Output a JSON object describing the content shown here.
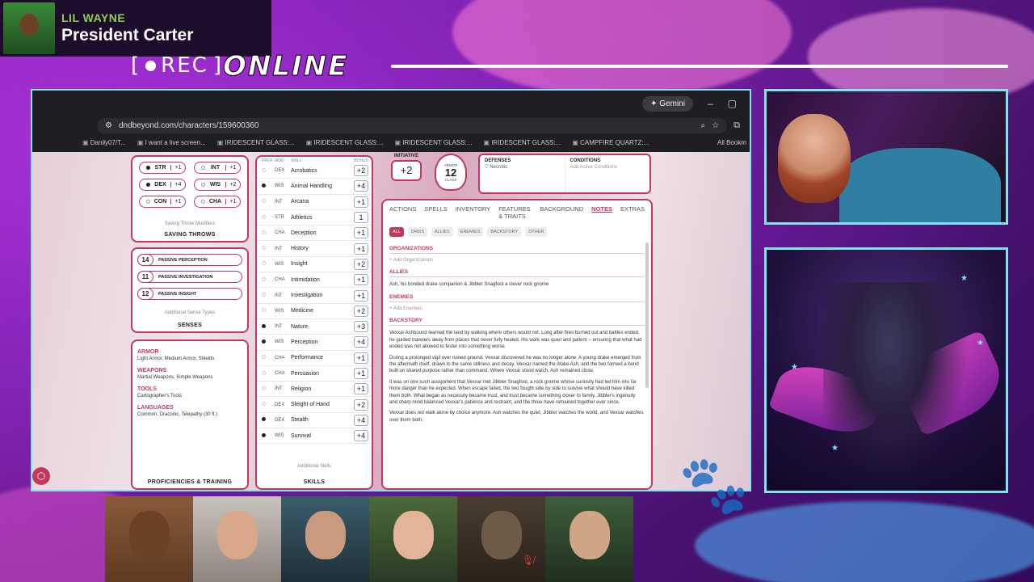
{
  "overlay": {
    "artist": "LIL WAYNE",
    "track": "President Carter",
    "rec_label": "REC",
    "online_label": "ONLINE"
  },
  "browser": {
    "gemini_label": "Gemini",
    "url": "dndbeyond.com/characters/159600360",
    "bookmarks": [
      "Danily07/T...",
      "I want a live screen...",
      "IRIDESCENT GLASS:...",
      "IRIDESCENT GLASS:...",
      "IRIDESCENT GLASS:...",
      "IRIDESCENT GLASS:...",
      "IRIDESCENT GLASS:...",
      "CAMPFIRE QUARTZ:..."
    ],
    "all_bookmarks": "All Bookm"
  },
  "saves": {
    "items": [
      {
        "ab": "STR",
        "val": "+1",
        "prof": true
      },
      {
        "ab": "INT",
        "val": "+1",
        "prof": false
      },
      {
        "ab": "DEX",
        "val": "+4",
        "prof": true
      },
      {
        "ab": "WIS",
        "val": "+2",
        "prof": false
      },
      {
        "ab": "CON",
        "val": "+1",
        "prof": false
      },
      {
        "ab": "CHA",
        "val": "+1",
        "prof": false
      }
    ],
    "modifiers": "Saving Throw Modifiers",
    "title": "SAVING THROWS"
  },
  "senses": {
    "items": [
      {
        "num": "14",
        "label": "PASSIVE PERCEPTION"
      },
      {
        "num": "11",
        "label": "PASSIVE INVESTIGATION"
      },
      {
        "num": "12",
        "label": "PASSIVE INSIGHT"
      }
    ],
    "additional": "Additional Sense Types",
    "title": "SENSES"
  },
  "proficiencies": {
    "armor_h": "ARMOR",
    "armor_v": "Light Armor, Medium Armor, Shields",
    "weapons_h": "WEAPONS",
    "weapons_v": "Martial Weapons, Simple Weapons",
    "tools_h": "TOOLS",
    "tools_v": "Cartographer's Tools",
    "languages_h": "LANGUAGES",
    "languages_v": "Common, Draconic, Telepathy (30 ft.)",
    "title": "PROFICIENCIES & TRAINING"
  },
  "skills": {
    "head": {
      "prof": "PROF",
      "mod": "MOD",
      "skill": "SKILL",
      "bonus": "BONUS"
    },
    "rows": [
      {
        "p": false,
        "m": "DEX",
        "n": "Acrobatics",
        "b": "+2"
      },
      {
        "p": true,
        "m": "WIS",
        "n": "Animal Handling",
        "b": "+4"
      },
      {
        "p": false,
        "m": "INT",
        "n": "Arcana",
        "b": "+1"
      },
      {
        "p": false,
        "m": "STR",
        "n": "Athletics",
        "b": "1"
      },
      {
        "p": false,
        "m": "CHA",
        "n": "Deception",
        "b": "+1"
      },
      {
        "p": false,
        "m": "INT",
        "n": "History",
        "b": "+1"
      },
      {
        "p": false,
        "m": "WIS",
        "n": "Insight",
        "b": "+2"
      },
      {
        "p": false,
        "m": "CHA",
        "n": "Intimidation",
        "b": "+1"
      },
      {
        "p": false,
        "m": "INT",
        "n": "Investigation",
        "b": "+1"
      },
      {
        "p": false,
        "m": "WIS",
        "n": "Medicine",
        "b": "+2"
      },
      {
        "p": true,
        "m": "INT",
        "n": "Nature",
        "b": "+3"
      },
      {
        "p": true,
        "m": "WIS",
        "n": "Perception",
        "b": "+4"
      },
      {
        "p": false,
        "m": "CHA",
        "n": "Performance",
        "b": "+1"
      },
      {
        "p": false,
        "m": "CHA",
        "n": "Persuasion",
        "b": "+1"
      },
      {
        "p": false,
        "m": "INT",
        "n": "Religion",
        "b": "+1"
      },
      {
        "p": false,
        "m": "DEX",
        "n": "Sleight of Hand",
        "b": "+2"
      },
      {
        "p": true,
        "m": "DEX",
        "n": "Stealth",
        "b": "+4"
      },
      {
        "p": true,
        "m": "WIS",
        "n": "Survival",
        "b": "+4"
      }
    ],
    "additional": "Additional Skills",
    "title": "SKILLS"
  },
  "initiative": {
    "label": "INITIATIVE",
    "value": "+2"
  },
  "armor": {
    "top": "ARMOR",
    "value": "12",
    "bottom": "CLASS"
  },
  "defenses": {
    "title": "DEFENSES",
    "value": "Necrotic"
  },
  "conditions": {
    "title": "CONDITIONS",
    "value": "Add Active Conditions"
  },
  "tabs": [
    "ACTIONS",
    "SPELLS",
    "INVENTORY",
    "FEATURES & TRAITS",
    "BACKGROUND",
    "NOTES",
    "EXTRAS"
  ],
  "subtabs": [
    "ALL",
    "ORGS",
    "ALLIES",
    "ENEMIES",
    "BACKSTORY",
    "OTHER"
  ],
  "notes": {
    "org_h": "ORGANIZATIONS",
    "org_add": "+ Add Organizations",
    "allies_h": "ALLIES",
    "allies_v": "Ash, his bonded drake companion & Jibbler Snagfoot a clever rock gnome",
    "enemies_h": "ENEMIES",
    "enemies_add": "+ Add Enemies",
    "backstory_h": "BACKSTORY",
    "p1": "Vexxar Ashbound learned the land by walking where others would not. Long after fires burned out and battles ended, he guided travelers away from places that never fully healed. His work was quiet and patient -- ensuring that what had ended was not allowed to fester into something worse.",
    "p2": "During a prolonged vigil over ruined ground, Vexxar discovered he was no longer alone. A young drake emerged from the aftermath itself, drawn to the same stillness and decay. Vexxar named the drake Ash, and the two formed a bond built on shared purpose rather than command. Where Vexxar stood watch, Ash remained close.",
    "p3": "It was on one such assignment that Vexxar met Jibbler Snagfoot, a rock gnome whose curiosity had led him into far more danger than he expected. When escape failed, the two fought side by side to survive what should have killed them both. What began as necessity became trust, and trust became something closer to family. Jibbler's ingenuity and sharp mind balanced Vexxar's patience and restraint, and the three have remained together ever since.",
    "p4": "Vexxar does not walk alone by choice anymore. Ash watches the quiet, Jibbler watches the world, and Vexxar watches over them both."
  },
  "colors": {
    "accent": "#c0395d",
    "frame": "#7fe4f0"
  }
}
